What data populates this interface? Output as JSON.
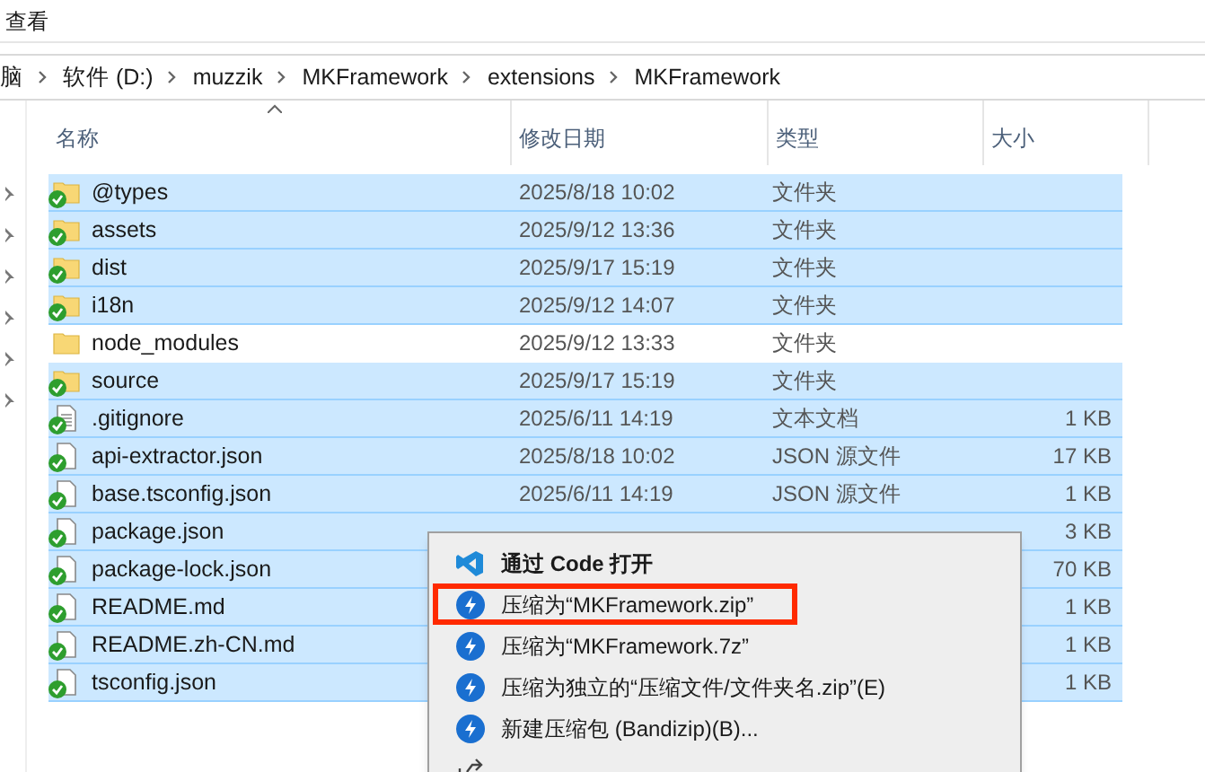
{
  "menu_bar": {
    "items": [
      "查看"
    ]
  },
  "breadcrumb": [
    "脑",
    "软件 (D:)",
    "muzzik",
    "MKFramework",
    "extensions",
    "MKFramework"
  ],
  "table": {
    "columns": [
      "名称",
      "修改日期",
      "类型",
      "大小"
    ],
    "rows": [
      {
        "kind": "folder",
        "synced": true,
        "selected": true,
        "name": "@types",
        "date": "2025/8/18 10:02",
        "type": "文件夹"
      },
      {
        "kind": "folder",
        "synced": true,
        "selected": true,
        "name": "assets",
        "date": "2025/9/12 13:36",
        "type": "文件夹"
      },
      {
        "kind": "folder",
        "synced": true,
        "selected": true,
        "name": "dist",
        "date": "2025/9/17 15:19",
        "type": "文件夹"
      },
      {
        "kind": "folder",
        "synced": true,
        "selected": true,
        "name": "i18n",
        "date": "2025/9/12 14:07",
        "type": "文件夹"
      },
      {
        "kind": "folder",
        "synced": false,
        "selected": false,
        "name": "node_modules",
        "date": "2025/9/12 13:33",
        "type": "文件夹"
      },
      {
        "kind": "folder",
        "synced": true,
        "selected": true,
        "name": "source",
        "date": "2025/9/17 15:19",
        "type": "文件夹"
      },
      {
        "kind": "text",
        "synced": true,
        "selected": true,
        "name": ".gitignore",
        "date": "2025/6/11 14:19",
        "type": "文本文档",
        "size": "1 KB"
      },
      {
        "kind": "file",
        "synced": true,
        "selected": true,
        "name": "api-extractor.json",
        "date": "2025/8/18 10:02",
        "type": "JSON 源文件",
        "size": "17 KB"
      },
      {
        "kind": "file",
        "synced": true,
        "selected": true,
        "name": "base.tsconfig.json",
        "date": "2025/6/11 14:19",
        "type": "JSON 源文件",
        "size": "1 KB"
      },
      {
        "kind": "file",
        "synced": true,
        "selected": true,
        "name": "package.json",
        "size": "3 KB"
      },
      {
        "kind": "file",
        "synced": true,
        "selected": true,
        "name": "package-lock.json",
        "size": "70 KB"
      },
      {
        "kind": "file",
        "synced": true,
        "selected": true,
        "name": "README.md",
        "size": "1 KB"
      },
      {
        "kind": "file",
        "synced": true,
        "selected": true,
        "name": "README.zh-CN.md",
        "size": "1 KB"
      },
      {
        "kind": "file",
        "synced": true,
        "selected": true,
        "name": "tsconfig.json",
        "size": "1 KB"
      }
    ]
  },
  "context_menu": {
    "items": [
      {
        "kind": "vscode",
        "label": "通过 Code 打开",
        "highlighted": false
      },
      {
        "kind": "bandizip",
        "label": "压缩为“MKFramework.zip”",
        "highlighted": true
      },
      {
        "kind": "bandizip",
        "label": "压缩为“MKFramework.7z”",
        "highlighted": false
      },
      {
        "kind": "bandizip",
        "label": "压缩为独立的“压缩文件/文件夹名.zip”(E)",
        "highlighted": false
      },
      {
        "kind": "bandizip",
        "label": "新建压缩包 (Bandizip)(B)...",
        "highlighted": false
      },
      {
        "kind": "share",
        "highlighted": false
      }
    ]
  }
}
